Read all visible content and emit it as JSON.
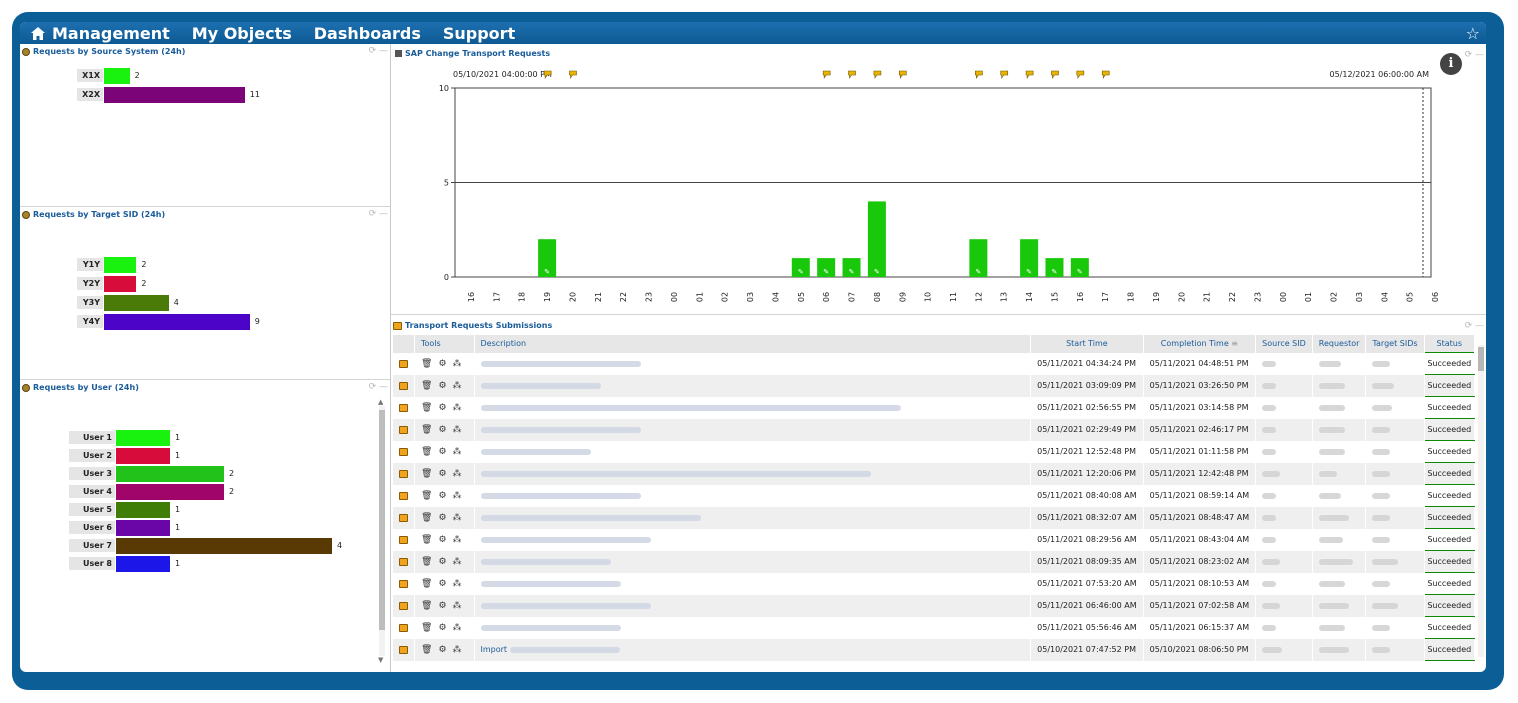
{
  "nav": {
    "items": [
      "Management",
      "My Objects",
      "Dashboards",
      "Support"
    ]
  },
  "panels": {
    "source": {
      "title": "Requests by Source System (24h)",
      "bars": [
        {
          "label": "X1X",
          "value": 2,
          "color": "#19f20f"
        },
        {
          "label": "X2X",
          "value": 11,
          "color": "#7a0478"
        }
      ]
    },
    "target": {
      "title": "Requests by Target SID (24h)",
      "bars": [
        {
          "label": "Y1Y",
          "value": 2,
          "color": "#19f20f"
        },
        {
          "label": "Y2Y",
          "value": 2,
          "color": "#d80c3a"
        },
        {
          "label": "Y3Y",
          "value": 4,
          "color": "#4a7a08"
        },
        {
          "label": "Y4Y",
          "value": 9,
          "color": "#4b04c8"
        }
      ]
    },
    "user": {
      "title": "Requests by User (24h)",
      "bars": [
        {
          "label": "User 1",
          "value": 1,
          "color": "#19f20f"
        },
        {
          "label": "User 2",
          "value": 1,
          "color": "#d80c3a"
        },
        {
          "label": "User 3",
          "value": 2,
          "color": "#22c21a"
        },
        {
          "label": "User 4",
          "value": 2,
          "color": "#a0066a"
        },
        {
          "label": "User 5",
          "value": 1,
          "color": "#3f7d06"
        },
        {
          "label": "User 6",
          "value": 1,
          "color": "#6a06a8"
        },
        {
          "label": "User 7",
          "value": 4,
          "color": "#5a3a04"
        },
        {
          "label": "User 8",
          "value": 1,
          "color": "#1c16e8"
        }
      ]
    }
  },
  "chart": {
    "title": "SAP Change Transport Requests",
    "start_label": "05/10/2021 04:00:00 PM",
    "end_label": "05/12/2021 06:00:00 AM",
    "info_icon": "info-icon"
  },
  "chart_data": {
    "type": "bar",
    "title": "SAP Change Transport Requests",
    "categories": [
      "16",
      "17",
      "18",
      "19",
      "20",
      "21",
      "22",
      "23",
      "00",
      "01",
      "02",
      "03",
      "04",
      "05",
      "06",
      "07",
      "08",
      "09",
      "10",
      "11",
      "12",
      "13",
      "14",
      "15",
      "16",
      "17",
      "18",
      "19",
      "20",
      "21",
      "22",
      "23",
      "00",
      "01",
      "02",
      "03",
      "04",
      "05",
      "06"
    ],
    "values": [
      0,
      0,
      0,
      2,
      0,
      0,
      0,
      0,
      0,
      0,
      0,
      0,
      0,
      1,
      1,
      1,
      4,
      0,
      0,
      0,
      2,
      0,
      2,
      1,
      1,
      0,
      0,
      0,
      0,
      0,
      0,
      0,
      0,
      0,
      0,
      0,
      0,
      0,
      0
    ],
    "ylim": [
      0,
      10
    ],
    "yticks": [
      0,
      5,
      10
    ],
    "color": "#19c80a",
    "grid": true
  },
  "grid": {
    "title": "Transport Requests Submissions",
    "columns": [
      "Tools",
      "Description",
      "Start Time",
      "Completion Time",
      "Source SID",
      "Requestor",
      "Target SIDs",
      "Status"
    ],
    "rows": [
      {
        "start": "05/11/2021 04:34:24 PM",
        "end": "05/11/2021 04:48:51 PM",
        "status": "Succeeded"
      },
      {
        "start": "05/11/2021 03:09:09 PM",
        "end": "05/11/2021 03:26:50 PM",
        "status": "Succeeded"
      },
      {
        "start": "05/11/2021 02:56:55 PM",
        "end": "05/11/2021 03:14:58 PM",
        "status": "Succeeded"
      },
      {
        "start": "05/11/2021 02:29:49 PM",
        "end": "05/11/2021 02:46:17 PM",
        "status": "Succeeded"
      },
      {
        "start": "05/11/2021 12:52:48 PM",
        "end": "05/11/2021 01:11:58 PM",
        "status": "Succeeded"
      },
      {
        "start": "05/11/2021 12:20:06 PM",
        "end": "05/11/2021 12:42:48 PM",
        "status": "Succeeded"
      },
      {
        "start": "05/11/2021 08:40:08 AM",
        "end": "05/11/2021 08:59:14 AM",
        "status": "Succeeded"
      },
      {
        "start": "05/11/2021 08:32:07 AM",
        "end": "05/11/2021 08:48:47 AM",
        "status": "Succeeded"
      },
      {
        "start": "05/11/2021 08:29:56 AM",
        "end": "05/11/2021 08:43:04 AM",
        "status": "Succeeded"
      },
      {
        "start": "05/11/2021 08:09:35 AM",
        "end": "05/11/2021 08:23:02 AM",
        "status": "Succeeded"
      },
      {
        "start": "05/11/2021 07:53:20 AM",
        "end": "05/11/2021 08:10:53 AM",
        "status": "Succeeded"
      },
      {
        "start": "05/11/2021 06:46:00 AM",
        "end": "05/11/2021 07:02:58 AM",
        "status": "Succeeded"
      },
      {
        "start": "05/11/2021 05:56:46 AM",
        "end": "05/11/2021 06:15:37 AM",
        "status": "Succeeded"
      },
      {
        "start": "05/10/2021 07:47:52 PM",
        "end": "05/10/2021 08:06:50 PM",
        "status": "Succeeded",
        "description": "Import"
      }
    ]
  }
}
